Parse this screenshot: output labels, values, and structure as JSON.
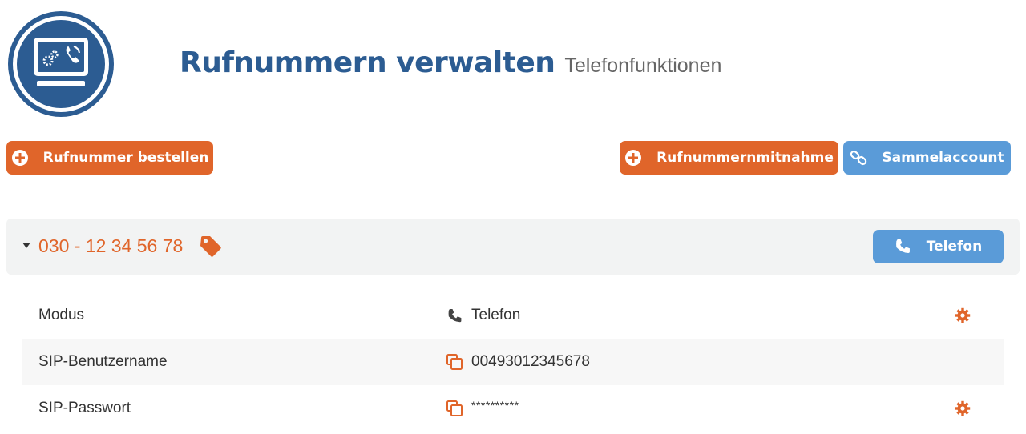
{
  "header": {
    "title": "Rufnummern verwalten",
    "subtitle": "Telefonfunktionen",
    "logo_icon": "computer-phone-icon"
  },
  "actions": {
    "order_label": "Rufnummer bestellen",
    "port_label": "Rufnummernmitnahme",
    "collective_label": "Sammelaccount"
  },
  "number_panel": {
    "number": "030 - 12 34 56 78",
    "expanded": true,
    "mode_button_label": "Telefon"
  },
  "details": [
    {
      "label": "Modus",
      "value": "Telefon",
      "value_icon": "phone-icon",
      "has_settings": true
    },
    {
      "label": "SIP-Benutzername",
      "value": "00493012345678",
      "value_icon": "copy-icon",
      "has_settings": false
    },
    {
      "label": "SIP-Passwort",
      "value": "**********",
      "value_icon": "copy-icon",
      "has_settings": true
    }
  ],
  "colors": {
    "primary_blue": "#2c5c92",
    "accent_orange": "#e0652a",
    "button_blue": "#5a9bd8",
    "panel_gray": "#f2f3f3"
  }
}
